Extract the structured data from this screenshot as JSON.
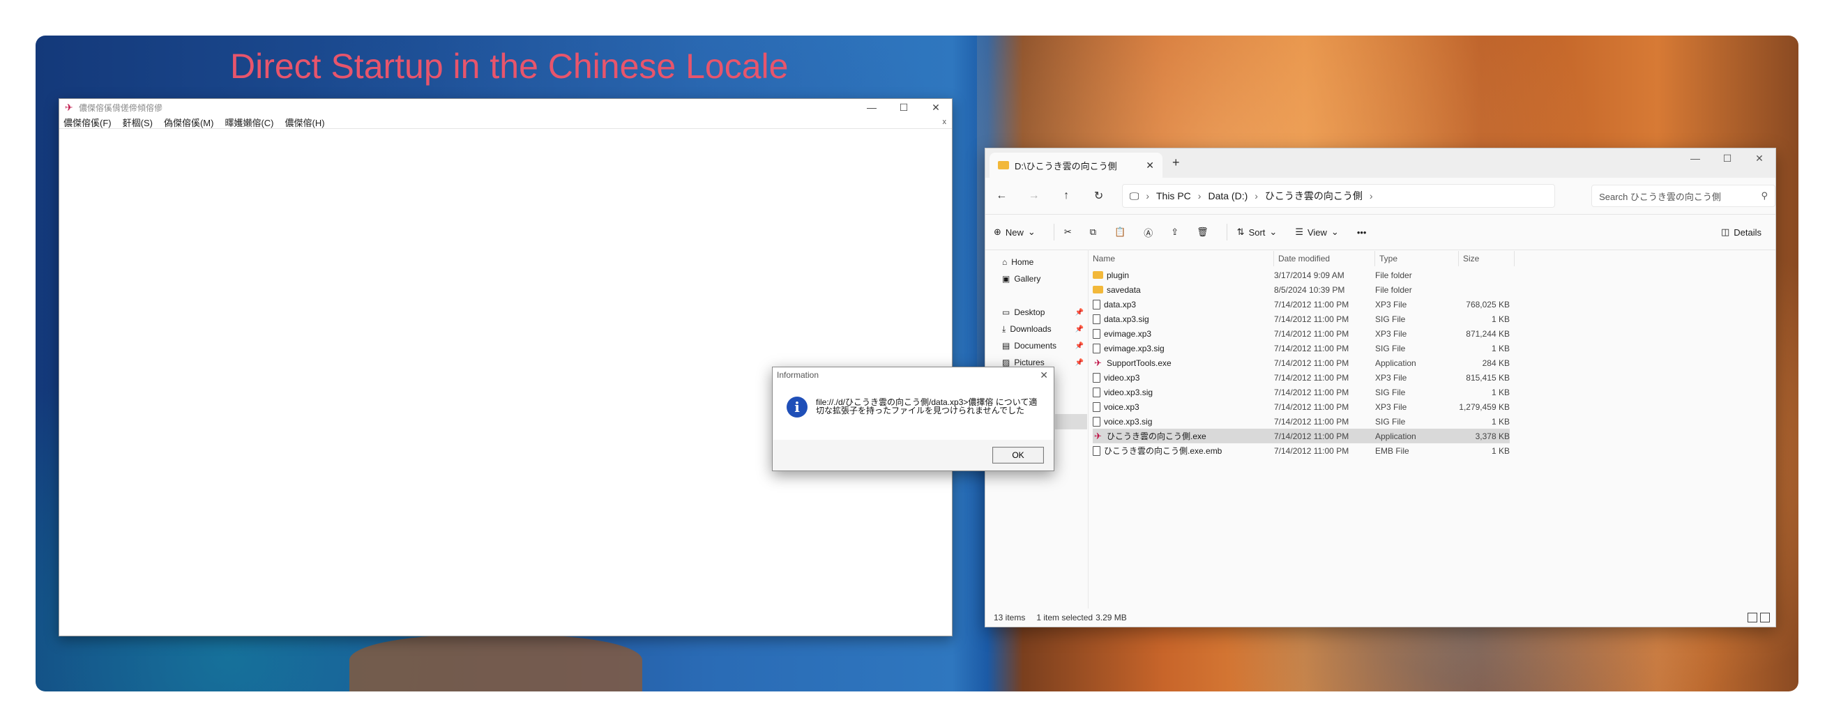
{
  "headline": "Direct Startup in the Chinese Locale",
  "left_window": {
    "title": "儂傑傛傒偝傞偙傾傛傪",
    "menu": [
      "儂傑傛傒(F)",
      "姧棝(S)",
      "偽傑傛傒(M)",
      "曎嬳嬾傛(C)",
      "儂傑傛(H)"
    ],
    "menu_close": "x",
    "controls": {
      "minimize": "—",
      "maximize": "☐",
      "close": "✕"
    }
  },
  "explorer": {
    "tab_title": "D:\\ひこうき雲の向こう側",
    "tab_close": "✕",
    "new_tab": "+",
    "controls": {
      "minimize": "—",
      "maximize": "☐",
      "close": "✕"
    },
    "nav": {
      "back": "←",
      "forward": "→",
      "up": "↑",
      "refresh": "↻"
    },
    "breadcrumb": [
      "This PC",
      "Data (D:)",
      "ひこうき雲の向こう側"
    ],
    "search_placeholder": "Search ひこうき雲の向こう側",
    "commands": {
      "new": "New",
      "sort": "Sort",
      "view": "View",
      "more": "•••",
      "details": "Details"
    },
    "sidebar": [
      {
        "label": "Home",
        "pinned": false
      },
      {
        "label": "Gallery",
        "pinned": false
      },
      {
        "label": "Desktop",
        "pinned": true
      },
      {
        "label": "Downloads",
        "pinned": true
      },
      {
        "label": "Documents",
        "pinned": true
      },
      {
        "label": "Pictures",
        "pinned": true
      }
    ],
    "columns": [
      "Name",
      "Date modified",
      "Type",
      "Size"
    ],
    "files": [
      {
        "name": "plugin",
        "date": "3/17/2014 9:09 AM",
        "type": "File folder",
        "size": "",
        "icon": "folder"
      },
      {
        "name": "savedata",
        "date": "8/5/2024 10:39 PM",
        "type": "File folder",
        "size": "",
        "icon": "folder"
      },
      {
        "name": "data.xp3",
        "date": "7/14/2012 11:00 PM",
        "type": "XP3 File",
        "size": "768,025 KB",
        "icon": "file"
      },
      {
        "name": "data.xp3.sig",
        "date": "7/14/2012 11:00 PM",
        "type": "SIG File",
        "size": "1 KB",
        "icon": "file"
      },
      {
        "name": "evimage.xp3",
        "date": "7/14/2012 11:00 PM",
        "type": "XP3 File",
        "size": "871,244 KB",
        "icon": "file"
      },
      {
        "name": "evimage.xp3.sig",
        "date": "7/14/2012 11:00 PM",
        "type": "SIG File",
        "size": "1 KB",
        "icon": "file"
      },
      {
        "name": "SupportTools.exe",
        "date": "7/14/2012 11:00 PM",
        "type": "Application",
        "size": "284 KB",
        "icon": "app"
      },
      {
        "name": "video.xp3",
        "date": "7/14/2012 11:00 PM",
        "type": "XP3 File",
        "size": "815,415 KB",
        "icon": "file"
      },
      {
        "name": "video.xp3.sig",
        "date": "7/14/2012 11:00 PM",
        "type": "SIG File",
        "size": "1 KB",
        "icon": "file"
      },
      {
        "name": "voice.xp3",
        "date": "7/14/2012 11:00 PM",
        "type": "XP3 File",
        "size": "1,279,459 KB",
        "icon": "file"
      },
      {
        "name": "voice.xp3.sig",
        "date": "7/14/2012 11:00 PM",
        "type": "SIG File",
        "size": "1 KB",
        "icon": "file"
      },
      {
        "name": "ひこうき雲の向こう側.exe",
        "date": "7/14/2012 11:00 PM",
        "type": "Application",
        "size": "3,378 KB",
        "icon": "app",
        "selected": true
      },
      {
        "name": "ひこうき雲の向こう側.exe.emb",
        "date": "7/14/2012 11:00 PM",
        "type": "EMB File",
        "size": "1 KB",
        "icon": "file"
      }
    ],
    "status": {
      "items": "13 items",
      "selected": "1 item selected",
      "size": "3.29 MB"
    }
  },
  "dialog": {
    "title": "Information",
    "close": "✕",
    "icon": "i",
    "message": "file://./d/ひこうき雲の向こう側/data.xp3>儂擇傛 について適切な拡張子を持ったファイルを見つけられませんでした",
    "ok": "OK"
  },
  "colors": {
    "headline": "#e8556c",
    "accent_app_icon": "#c0174a",
    "folder": "#f2b83a",
    "info_icon": "#1f4fb8"
  }
}
